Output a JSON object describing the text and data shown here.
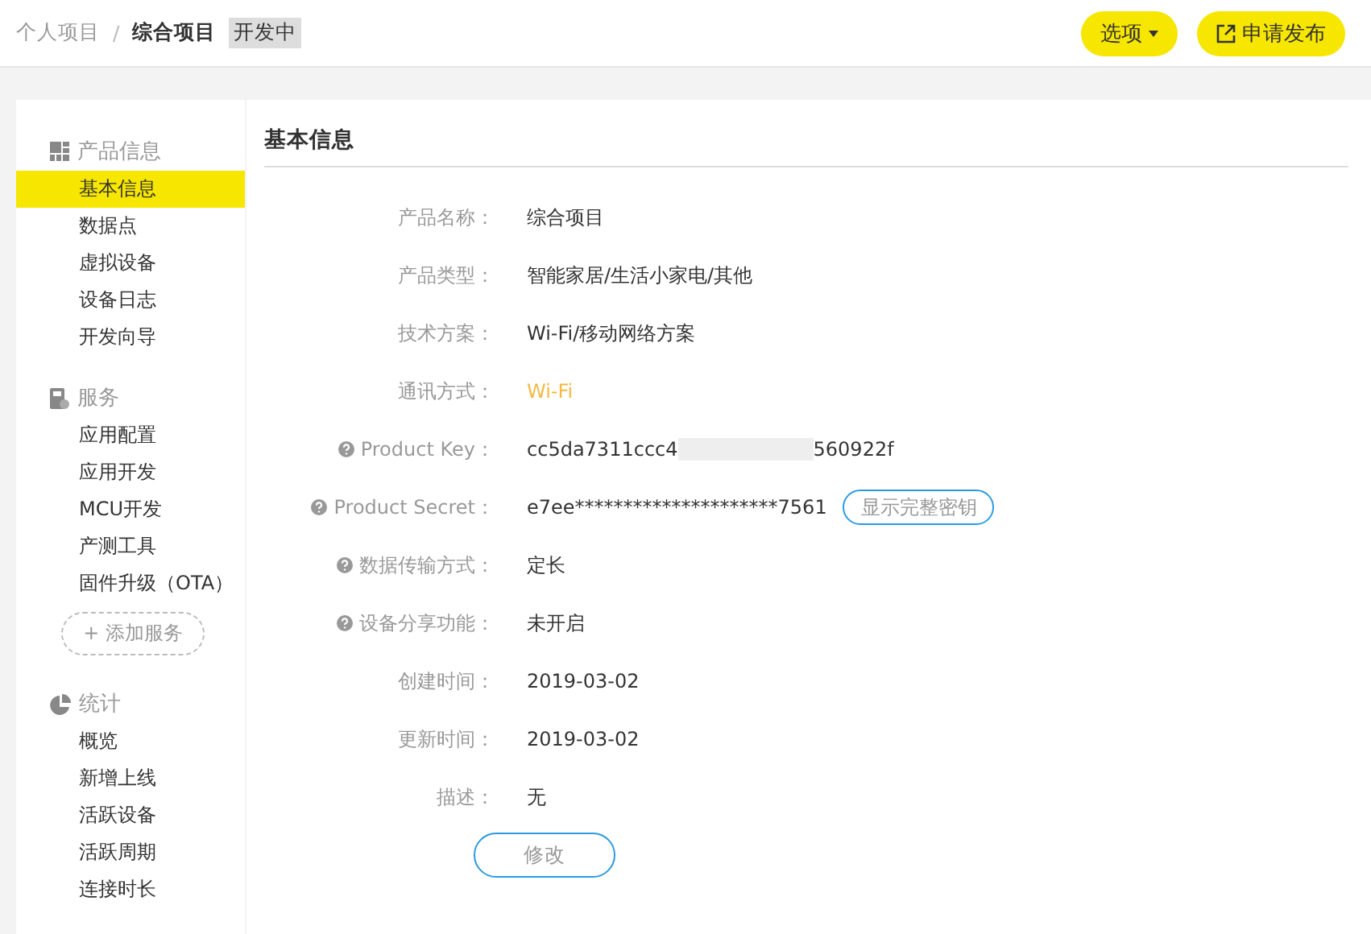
{
  "breadcrumb": {
    "parent": "个人项目",
    "separator": "/",
    "current": "综合项目",
    "status": "开发中"
  },
  "header_buttons": [
    {
      "label": "选项",
      "kind": "dropdown"
    },
    {
      "label": "申请发布",
      "kind": "external"
    }
  ],
  "sidebar": {
    "sections": [
      {
        "title": "产品信息",
        "kind": "grid",
        "items": [
          {
            "label": "基本信息",
            "selected": true
          },
          {
            "label": "数据点",
            "selected": false
          },
          {
            "label": "虚拟设备",
            "selected": false
          },
          {
            "label": "设备日志",
            "selected": false
          },
          {
            "label": "开发向导",
            "selected": false
          }
        ]
      },
      {
        "title": "服务",
        "kind": "device",
        "items": [
          {
            "label": "应用配置",
            "selected": false
          },
          {
            "label": "应用开发",
            "selected": false
          },
          {
            "label": "MCU开发",
            "selected": false
          },
          {
            "label": "产测工具",
            "selected": false
          },
          {
            "label": "固件升级（OTA）",
            "selected": false
          }
        ],
        "add_button": "+ 添加服务"
      },
      {
        "title": "统计",
        "kind": "pie",
        "items": [
          {
            "label": "概览",
            "selected": false
          },
          {
            "label": "新增上线",
            "selected": false
          },
          {
            "label": "活跃设备",
            "selected": false
          },
          {
            "label": "活跃周期",
            "selected": false
          },
          {
            "label": "连接时长",
            "selected": false
          }
        ]
      }
    ]
  },
  "main": {
    "title": "基本信息",
    "fields": [
      {
        "label": "产品名称：",
        "kind": "text",
        "help": false,
        "value": "综合项目"
      },
      {
        "label": "产品类型：",
        "kind": "text",
        "help": false,
        "value": "智能家居/生活小家电/其他"
      },
      {
        "label": "技术方案：",
        "kind": "text",
        "help": false,
        "value": "Wi-Fi/移动网络方案"
      },
      {
        "label": "通讯方式：",
        "kind": "accent",
        "help": false,
        "value": "Wi-Fi"
      },
      {
        "label": "Product Key：",
        "kind": "redacted",
        "help": true,
        "value": "cc5da7311ccc4",
        "value_end": "560922f"
      },
      {
        "label": "Product Secret：",
        "kind": "secret",
        "help": true,
        "value": "e7ee*********************7561",
        "button": "显示完整密钥"
      },
      {
        "label": "数据传输方式：",
        "kind": "text",
        "help": true,
        "value": "定长"
      },
      {
        "label": "设备分享功能：",
        "kind": "text",
        "help": true,
        "value": "未开启"
      },
      {
        "label": "创建时间：",
        "kind": "text",
        "help": false,
        "value": "2019-03-02"
      },
      {
        "label": "更新时间：",
        "kind": "text",
        "help": false,
        "value": "2019-03-02"
      },
      {
        "label": "描述：",
        "kind": "text",
        "help": false,
        "value": "无"
      }
    ],
    "edit_button": "修改"
  }
}
